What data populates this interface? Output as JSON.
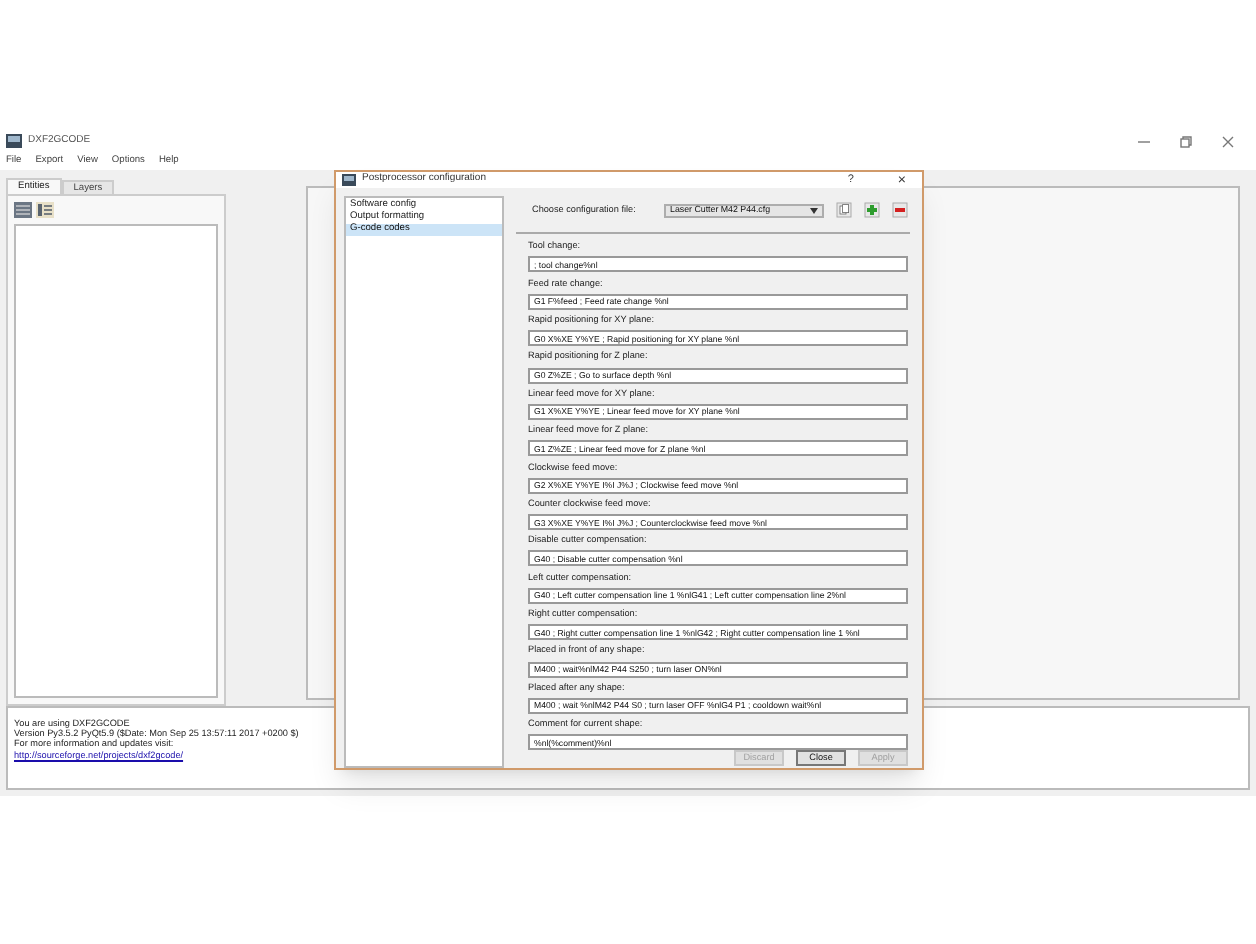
{
  "main_window": {
    "title": "DXF2GCODE",
    "menu": [
      "File",
      "Export",
      "View",
      "Options",
      "Help"
    ],
    "tabs": [
      {
        "label": "Entities",
        "selected": true
      },
      {
        "label": "Layers",
        "selected": false
      }
    ]
  },
  "log": {
    "lines": [
      "You are using DXF2GCODE",
      "Version Py3.5.2 PyQt5.9 ($Date: Mon Sep 25 13:57:11 2017 +0200 $)",
      "For more information and updates visit:"
    ],
    "link": "http://sourceforge.net/projects/dxf2gcode/"
  },
  "dialog": {
    "title": "Postprocessor configuration",
    "help": "?",
    "close": "×",
    "sections": [
      {
        "label": "Software config",
        "selected": false
      },
      {
        "label": "Output formatting",
        "selected": false
      },
      {
        "label": "G-code codes",
        "selected": true
      }
    ],
    "config_label": "Choose configuration file:",
    "config_file": "Laser Cutter M42 P44.cfg",
    "fields": [
      {
        "label": "Tool change:",
        "value": "; tool change%nl"
      },
      {
        "label": "Feed rate change:",
        "value": "G1 F%feed ; Feed rate change %nl"
      },
      {
        "label": "Rapid positioning for XY plane:",
        "value": "G0 X%XE Y%YE ; Rapid positioning for XY plane %nl"
      },
      {
        "label": "Rapid positioning for Z plane:",
        "value": "G0 Z%ZE ; Go to surface depth %nl"
      },
      {
        "label": "Linear feed move for XY plane:",
        "value": "G1 X%XE Y%YE ; Linear feed move for XY plane %nl"
      },
      {
        "label": "Linear feed move for Z plane:",
        "value": "G1 Z%ZE ; Linear feed move for Z plane %nl"
      },
      {
        "label": "Clockwise feed move:",
        "value": "G2 X%XE Y%YE I%I J%J ; Clockwise feed move %nl"
      },
      {
        "label": "Counter clockwise feed move:",
        "value": "G3 X%XE Y%YE I%I J%J ; Counterclockwise feed move %nl"
      },
      {
        "label": "Disable cutter compensation:",
        "value": "G40 ; Disable cutter compensation %nl"
      },
      {
        "label": "Left cutter compensation:",
        "value": "G40 ; Left cutter compensation line 1 %nlG41 ; Left cutter compensation line 2%nl"
      },
      {
        "label": "Right cutter compensation:",
        "value": "G40 ; Right cutter compensation line 1 %nlG42 ; Right cutter compensation line 1 %nl"
      },
      {
        "label": "Placed in front of any shape:",
        "value": "M400 ; wait%nlM42 P44 S250 ; turn laser ON%nl"
      },
      {
        "label": "Placed after any shape:",
        "value": "M400 ; wait %nlM42 P44 S0 ; turn laser OFF %nlG4 P1 ; cooldown wait%nl"
      },
      {
        "label": "Comment for current shape:",
        "value": "%nl(%comment)%nl"
      }
    ],
    "buttons": [
      {
        "label": "Discard",
        "disabled": true
      },
      {
        "label": "Close",
        "disabled": false
      },
      {
        "label": "Apply",
        "disabled": true
      }
    ]
  }
}
